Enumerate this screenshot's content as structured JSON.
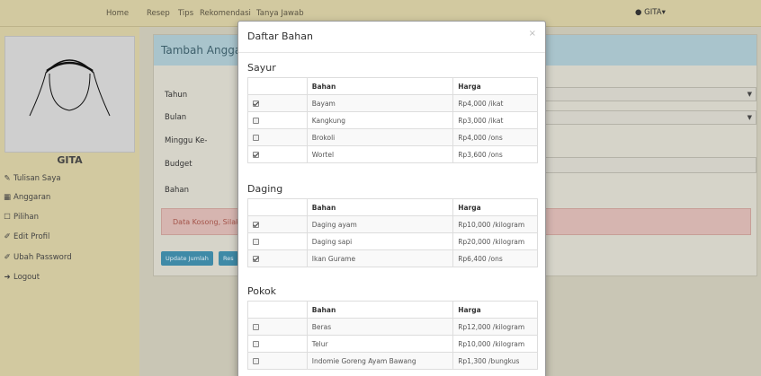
{
  "topnav": {
    "items": [
      "Home",
      "Resep",
      "Tips",
      "Rekomendasi",
      "Tanya Jawab"
    ],
    "user": "GITA"
  },
  "sidebar": {
    "name": "GITA",
    "items": [
      {
        "label": "Tulisan Saya",
        "icon": "edit-icon"
      },
      {
        "label": "Anggaran",
        "icon": "calculator-icon"
      },
      {
        "label": "Pilihan",
        "icon": "bookmark-icon"
      },
      {
        "label": "Edit Profil",
        "icon": "pencil-icon"
      },
      {
        "label": "Ubah Password",
        "icon": "pencil-icon"
      },
      {
        "label": "Logout",
        "icon": "logout-icon"
      }
    ]
  },
  "panel": {
    "title": "Tambah Anggaran",
    "labels": [
      "Tahun",
      "Bulan",
      "Minggu Ke-",
      "Budget",
      "Bahan"
    ],
    "alert": "Data Kosong, Silakan",
    "buttons": [
      "Update Jumlah",
      "Res"
    ]
  },
  "modal": {
    "title": "Daftar Bahan",
    "close": "×",
    "columns": {
      "bahan": "Bahan",
      "harga": "Harga"
    },
    "sections": [
      {
        "name": "Sayur",
        "rows": [
          {
            "checked": true,
            "bahan": "Bayam",
            "harga": "Rp4,000 /ikat"
          },
          {
            "checked": false,
            "bahan": "Kangkung",
            "harga": "Rp3,000 /ikat"
          },
          {
            "checked": false,
            "bahan": "Brokoli",
            "harga": "Rp4,000 /ons"
          },
          {
            "checked": true,
            "bahan": "Wortel",
            "harga": "Rp3,600 /ons"
          }
        ]
      },
      {
        "name": "Daging",
        "rows": [
          {
            "checked": true,
            "bahan": "Daging ayam",
            "harga": "Rp10,000 /kilogram"
          },
          {
            "checked": false,
            "bahan": "Daging sapi",
            "harga": "Rp20,000 /kilogram"
          },
          {
            "checked": true,
            "bahan": "Ikan Gurame",
            "harga": "Rp6,400 /ons"
          }
        ]
      },
      {
        "name": "Pokok",
        "rows": [
          {
            "checked": false,
            "bahan": "Beras",
            "harga": "Rp12,000 /kilogram"
          },
          {
            "checked": false,
            "bahan": "Telur",
            "harga": "Rp10,000 /kilogram"
          },
          {
            "checked": false,
            "bahan": "Indomie Goreng Ayam Bawang",
            "harga": "Rp1,300 /bungkus"
          }
        ]
      }
    ]
  }
}
